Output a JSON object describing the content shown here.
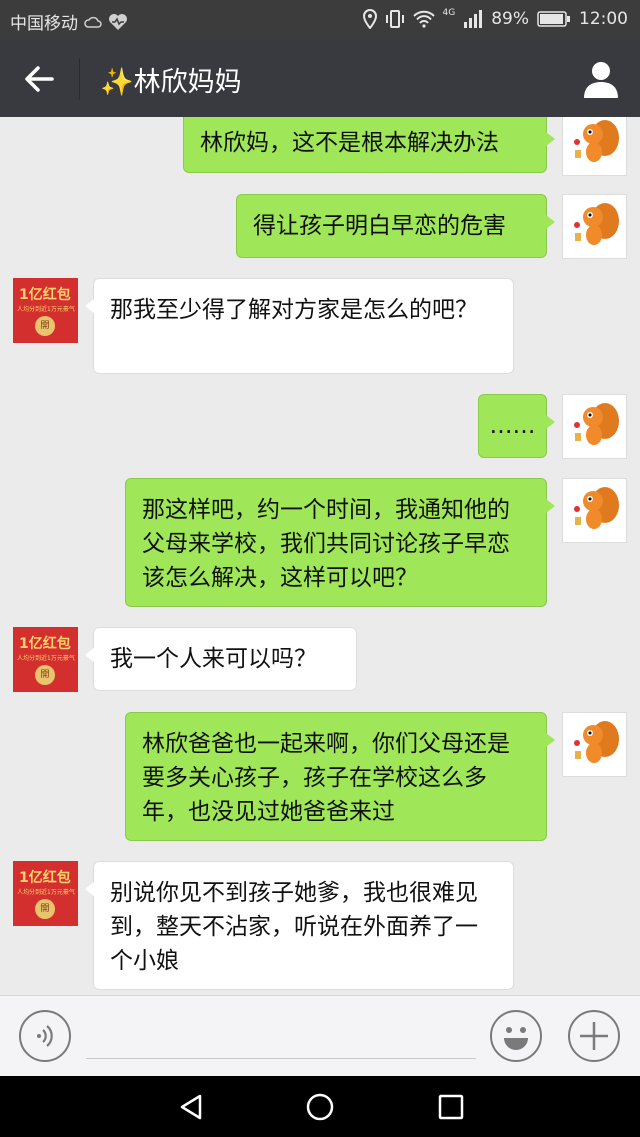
{
  "status_bar": {
    "carrier": "中国移动",
    "network": "4G",
    "battery": "89%",
    "time": "12:00"
  },
  "navbar": {
    "title_emoji": "✨",
    "title": "林欣妈妈"
  },
  "avatar_badge": {
    "line1": "1亿红包",
    "line2": "人均分到近1万元豪气",
    "coin": "開"
  },
  "messages": [
    {
      "side": "me",
      "text": "林欣妈，这不是根本解决办法"
    },
    {
      "side": "me",
      "text": "得让孩子明白早恋的危害"
    },
    {
      "side": "other",
      "text": "那我至少得了解对方家是怎么的吧？"
    },
    {
      "side": "me",
      "text": "……"
    },
    {
      "side": "me",
      "text": "那这样吧，约一个时间，我通知他的父母来学校，我们共同讨论孩子早恋该怎么解决，这样可以吧？"
    },
    {
      "side": "other",
      "text": "我一个人来可以吗？"
    },
    {
      "side": "me",
      "text": "林欣爸爸也一起来啊，你们父母还是要多关心孩子，孩子在学校这么多年，也没见过她爸爸来过"
    },
    {
      "side": "other",
      "text": "别说你见不到孩子她爹，我也很难见到，整天不沾家，听说在外面养了一个小娘"
    }
  ],
  "colors": {
    "my_bubble": "#9fe658",
    "navbar": "#393a3f",
    "chat_bg": "#ebebeb"
  }
}
